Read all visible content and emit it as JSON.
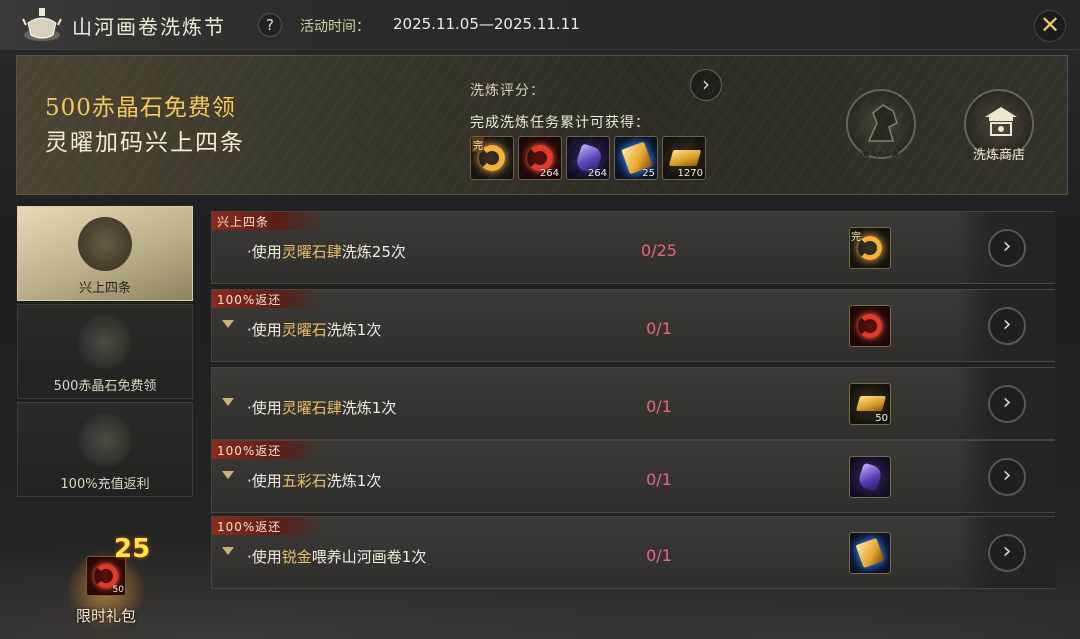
{
  "header": {
    "title": "山河画卷洗炼节",
    "help_label": "?",
    "time_label": "活动时间：",
    "time_value": "2025.11.05—2025.11.11",
    "close_label": "✕"
  },
  "banner": {
    "line1": "500赤晶石免费领",
    "line2": "灵曜加码兴上四条",
    "score_label": "洗炼评分：",
    "score_button": "›",
    "reward_label": "完成洗炼任务累计可获得：",
    "rewards": [
      {
        "icon": "gold-ring-icon",
        "count": "",
        "tag": "完"
      },
      {
        "icon": "red-ring-icon",
        "count": "264",
        "tag": ""
      },
      {
        "icon": "purple-gem-icon",
        "count": "264",
        "tag": ""
      },
      {
        "icon": "gold-book-icon",
        "count": "25",
        "tag": ""
      },
      {
        "icon": "gold-bar-icon",
        "count": "1270",
        "tag": ""
      }
    ],
    "stars": "★★★",
    "shop_label": "洗炼商店"
  },
  "sidebar": {
    "items": [
      {
        "label": "兴上四条",
        "active": true
      },
      {
        "label": "500赤晶石免费领",
        "active": false
      },
      {
        "label": "100%充值返利",
        "active": false
      }
    ],
    "gift": {
      "number": "25",
      "count": "50",
      "label": "限时礼包"
    }
  },
  "tasks": [
    {
      "tag": "兴上四条",
      "prefix": "·使用",
      "highlight": "灵曜石肆",
      "suffix": "洗炼25次",
      "progress": "0/25",
      "reward_count": "",
      "reward_tag": "完",
      "has_arrow": false
    },
    {
      "tag": "100%返还",
      "prefix": "·使用",
      "highlight": "灵曜石",
      "suffix": "洗炼1次",
      "progress": "0/1",
      "reward_count": "",
      "reward_tag": "",
      "has_arrow": true
    },
    {
      "tag": "",
      "prefix": "·使用",
      "highlight": "灵曜石肆",
      "suffix": "洗炼1次",
      "progress": "0/1",
      "reward_count": "50",
      "reward_tag": "",
      "has_arrow": true
    },
    {
      "tag": "100%返还",
      "prefix": "·使用",
      "highlight": "五彩石",
      "suffix": "洗炼1次",
      "progress": "0/1",
      "reward_count": "",
      "reward_tag": "",
      "has_arrow": true
    },
    {
      "tag": "100%返还",
      "prefix": "·使用",
      "highlight": "锐金",
      "suffix": "喂养山河画卷1次",
      "progress": "0/1",
      "reward_count": "",
      "reward_tag": "",
      "has_arrow": true
    }
  ],
  "go_label": "›",
  "colors": {
    "accent_gold": "#f1c95b",
    "progress_red": "#e8677a",
    "highlight": "#e6c16a"
  }
}
